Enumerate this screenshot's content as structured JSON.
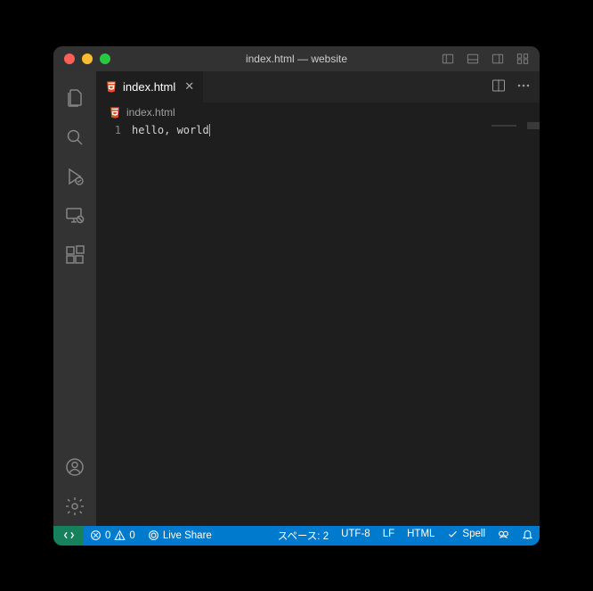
{
  "titlebar": {
    "title": "index.html — website"
  },
  "tab": {
    "filename": "index.html"
  },
  "breadcrumb": {
    "filename": "index.html"
  },
  "editor": {
    "line_number": "1",
    "content": "hello, world"
  },
  "statusbar": {
    "errors": "0",
    "warnings": "0",
    "live_share": "Live Share",
    "indent": "スペース: 2",
    "encoding": "UTF-8",
    "eol": "LF",
    "language": "HTML",
    "spell": "Spell"
  }
}
